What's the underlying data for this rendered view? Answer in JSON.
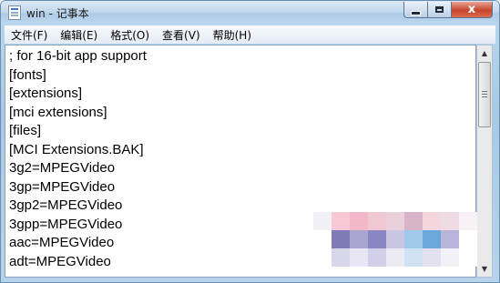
{
  "window": {
    "title": "win - 记事本"
  },
  "controls": {
    "close_symbol": "x"
  },
  "menu": [
    {
      "label": "文件(F)"
    },
    {
      "label": "编辑(E)"
    },
    {
      "label": "格式(O)"
    },
    {
      "label": "查看(V)"
    },
    {
      "label": "帮助(H)"
    }
  ],
  "editor": {
    "lines": [
      "; for 16-bit app support",
      "[fonts]",
      "[extensions]",
      "[mci extensions]",
      "[files]",
      "[MCI Extensions.BAK]",
      "3g2=MPEGVideo",
      "3gp=MPEGVideo",
      "3gp2=MPEGVideo",
      "3gpp=MPEGVideo",
      "aac=MPEGVideo",
      "adt=MPEGVideo"
    ]
  },
  "scrollbar": {
    "up_arrow": "▲",
    "down_arrow": "▼"
  },
  "colors": {
    "mosaic": [
      "#f2f0f7",
      "#f6c7d4",
      "#f3b8c7",
      "#efc8d4",
      "#e9d0dc",
      "#d9b4c8",
      "#f4d6df",
      "#eedbe4",
      "#f8f1f5",
      "#ffffff",
      "#7f7ab8",
      "#a8a6d0",
      "#8a86c2",
      "#c8c6e2",
      "#9fc9ea",
      "#6aa8dc",
      "#b7b4d9",
      "#ffffff",
      "#ffffff",
      "#d8d7ea",
      "#e8e6f2",
      "#d2d0e8",
      "#ecebf4",
      "#cfe1f2",
      "#e3e0f0",
      "#f2f1f8",
      "#ffffff"
    ]
  }
}
